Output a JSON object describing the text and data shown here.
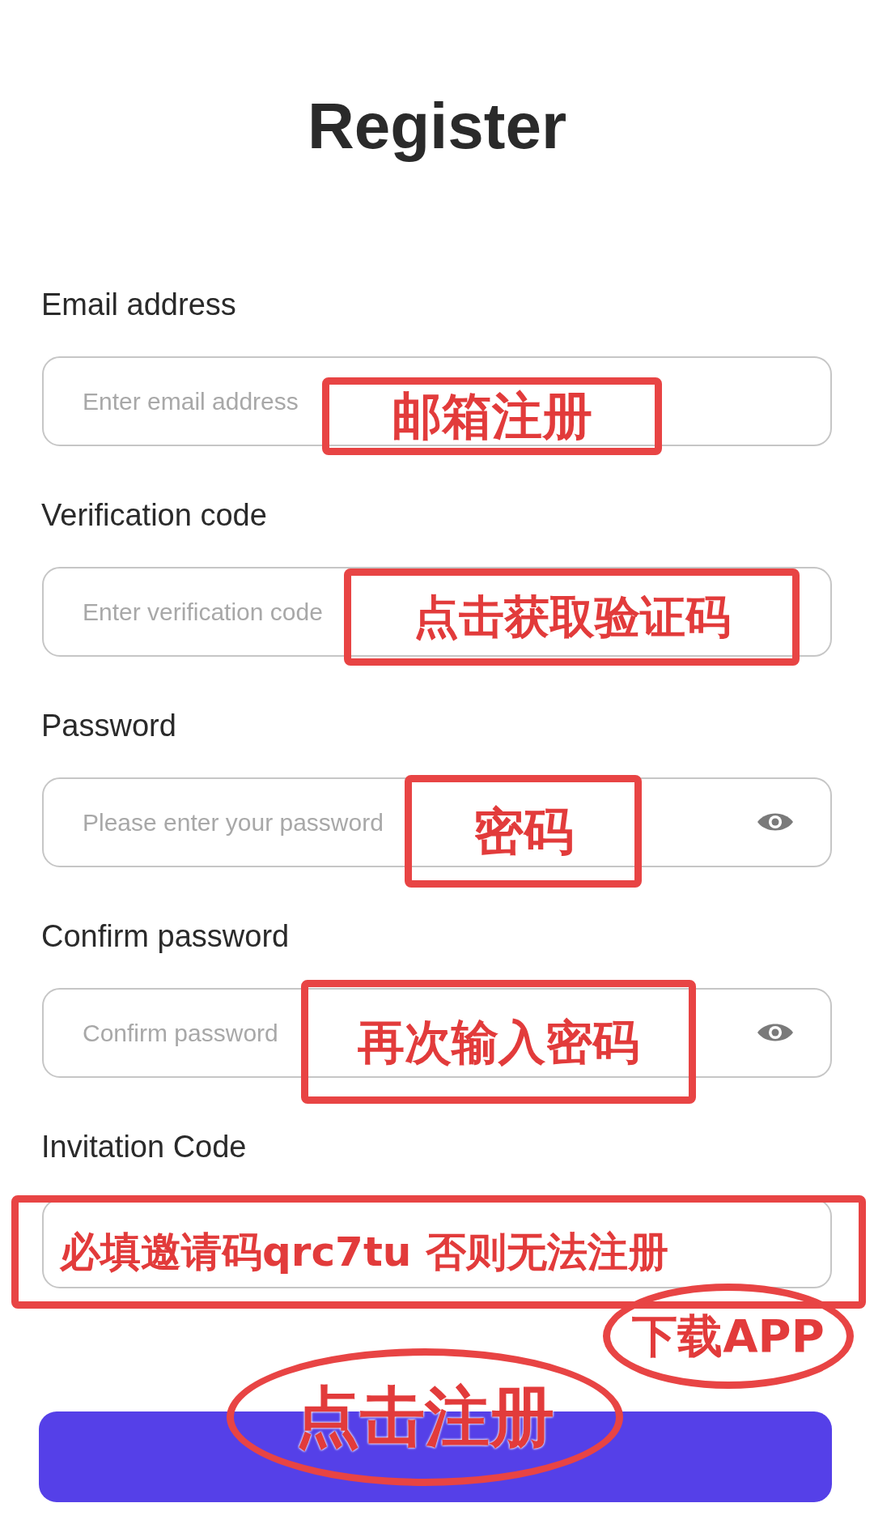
{
  "title": "Register",
  "fields": [
    {
      "label": "Email address",
      "placeholder": "Enter email address",
      "kind": "text"
    },
    {
      "label": "Verification code",
      "placeholder": "Enter verification code",
      "kind": "text"
    },
    {
      "label": "Password",
      "placeholder": "Please enter your password",
      "kind": "password"
    },
    {
      "label": "Confirm password",
      "placeholder": "Confirm password",
      "kind": "password"
    },
    {
      "label": "Invitation Code",
      "kind": "text"
    }
  ],
  "annotations": [
    {
      "kind": "box",
      "text": "邮箱注册"
    },
    {
      "kind": "box",
      "text": "点击获取验证码"
    },
    {
      "kind": "box",
      "text": "密码"
    },
    {
      "kind": "box",
      "text": "再次输入密码"
    },
    {
      "kind": "box",
      "text": "必填邀请码qrc7tu  否则无法注册"
    },
    {
      "kind": "ellipse",
      "text": "下载APP"
    },
    {
      "kind": "ellipse",
      "text": "点击注册"
    }
  ]
}
